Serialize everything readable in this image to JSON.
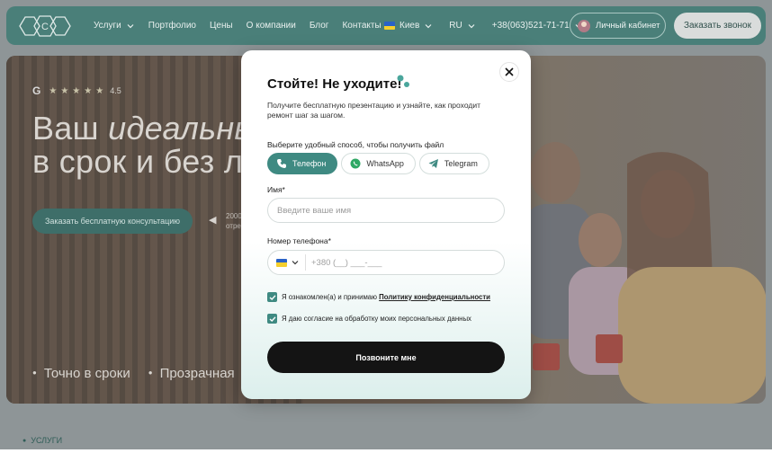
{
  "header": {
    "logo_letter": "С",
    "nav": [
      {
        "label": "Услуги",
        "has_dropdown": true
      },
      {
        "label": "Портфолио",
        "has_dropdown": false
      },
      {
        "label": "Цены",
        "has_dropdown": false
      },
      {
        "label": "О компании",
        "has_dropdown": false
      },
      {
        "label": "Блог",
        "has_dropdown": false
      },
      {
        "label": "Контакты",
        "has_dropdown": false
      }
    ],
    "city": "Киев",
    "language": "RU",
    "phone": "+38(063)521-71-71",
    "cabinet_label": "Личный кабинет",
    "callback_label": "Заказать звонок",
    "colors": {
      "header_bg": "#4a7f79",
      "accent": "#3f8a82"
    }
  },
  "hero": {
    "rating_provider_icon": "google-icon",
    "rating_stars": 5,
    "rating_value": "4.5",
    "title_line1_plain": "Ваш ",
    "title_line1_italic": "идеальны",
    "title_line2": "в срок и без л",
    "cta_label": "Заказать бесплатную консультацию",
    "side_text_line1": "2000",
    "side_text_line2": "отре",
    "bullets": [
      "Точно в сроки",
      "Прозрачная"
    ]
  },
  "section_label": "УСЛУГИ",
  "modal": {
    "title": "Стойте! Не уходите!",
    "description": "Получите бесплатную презентацию и узнайте, как проходит ремонт шаг за шагом.",
    "method_label": "Выберите удобный способ, чтобы получить файл",
    "methods": [
      {
        "label": "Телефон",
        "icon": "phone-icon",
        "active": true
      },
      {
        "label": "WhatsApp",
        "icon": "whatsapp-icon",
        "active": false
      },
      {
        "label": "Telegram",
        "icon": "telegram-icon",
        "active": false
      }
    ],
    "name_label": "Имя*",
    "name_placeholder": "Введите ваше имя",
    "phone_label": "Номер телефона*",
    "phone_placeholder": "+380 (__) ___-___",
    "consent1_text": "Я ознакомлен(а) и принимаю ",
    "consent1_link": "Политику конфиденциальности",
    "consent1_checked": true,
    "consent2_text": "Я даю согласие на обработку моих персональных данных",
    "consent2_checked": true,
    "submit_label": "Позвоните мне",
    "close_icon": "close-icon"
  }
}
